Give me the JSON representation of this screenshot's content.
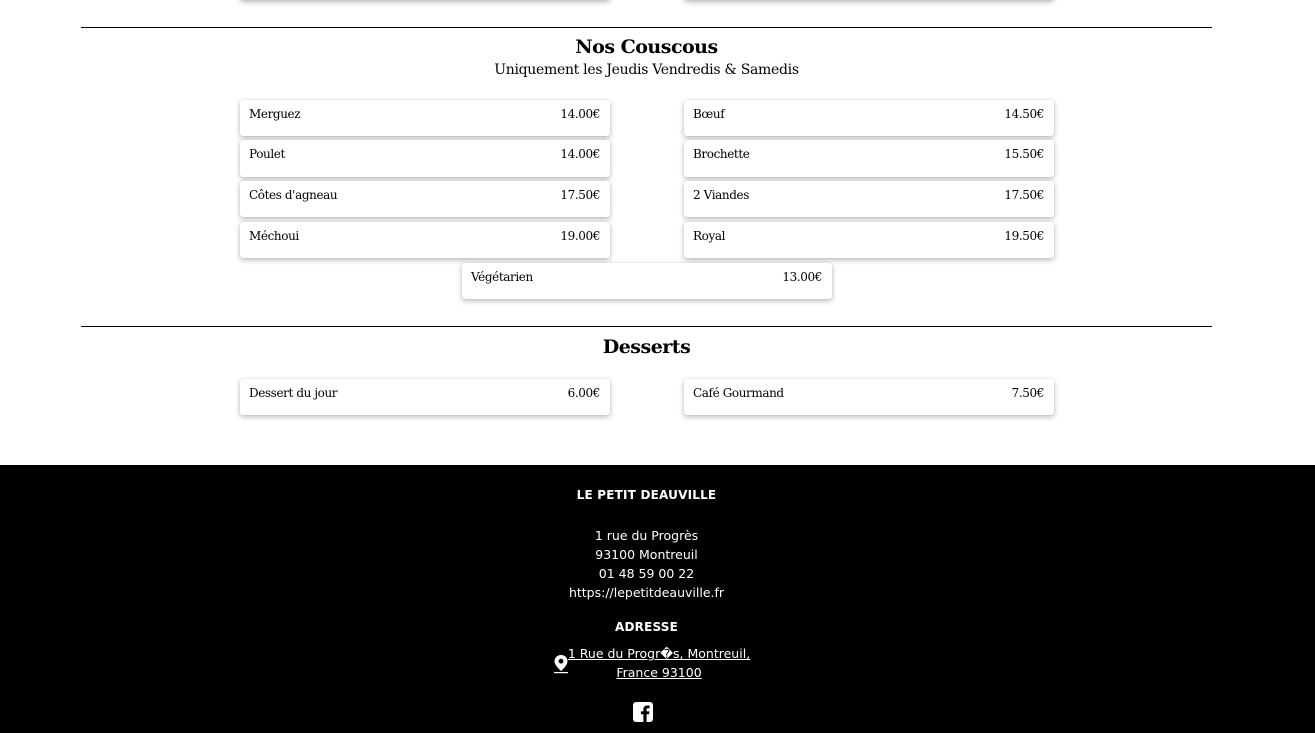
{
  "couscous": {
    "title": "Nos Couscous",
    "subtitle": "Uniquement les Jeudis Vendredis & Samedis",
    "left": [
      {
        "name": "Merguez",
        "price": "14.00€"
      },
      {
        "name": "Poulet",
        "price": "14.00€"
      },
      {
        "name": "Côtes d'agneau",
        "price": "17.50€"
      },
      {
        "name": "Méchoui",
        "price": "19.00€"
      }
    ],
    "right": [
      {
        "name": "Bœuf",
        "price": "14.50€"
      },
      {
        "name": "Brochette",
        "price": "15.50€"
      },
      {
        "name": "2 Viandes",
        "price": "17.50€"
      },
      {
        "name": "Royal",
        "price": "19.50€"
      }
    ],
    "center": {
      "name": "Végétarien",
      "price": "13.00€"
    }
  },
  "desserts": {
    "title": "Desserts",
    "left": {
      "name": "Dessert du jour",
      "price": "6.00€"
    },
    "right": {
      "name": "Café Gourmand",
      "price": "7.50€"
    }
  },
  "footer": {
    "brand": "LE PETIT DEAUVILLE",
    "street": "1 rue du Progrès",
    "city": "93100 Montreuil",
    "phone": "01 48 59 00 22",
    "website": "https://lepetitdeauville.fr",
    "address_heading": "ADRESSE",
    "address_line1": "1 Rue du Progr�s, Montreuil,",
    "address_line2": "France 93100",
    "icons": {
      "map": "map-pin-icon",
      "social": "facebook-icon"
    }
  }
}
